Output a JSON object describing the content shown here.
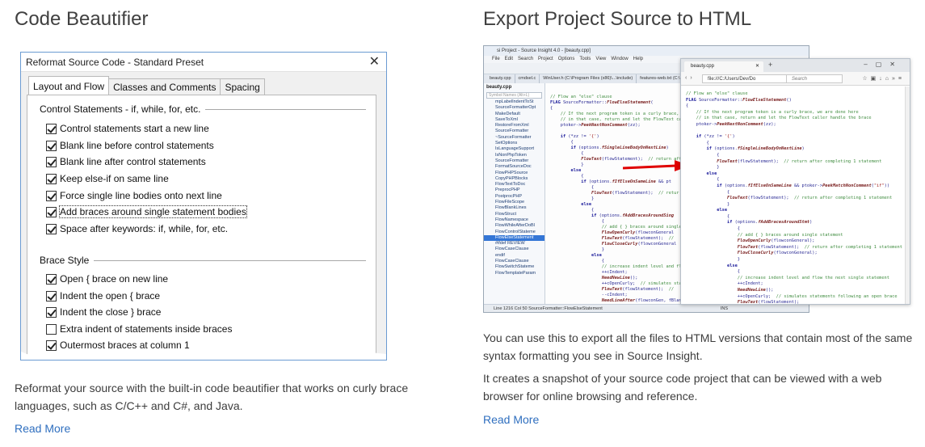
{
  "left": {
    "title": "Code Beautifier",
    "dialog": {
      "title": "Reformat Source Code - Standard Preset",
      "tabs": [
        "Layout and Flow",
        "Classes and Comments",
        "Spacing"
      ],
      "groups": [
        {
          "label": "Control Statements - if, while, for, etc.",
          "options": [
            {
              "label": "Control statements start a new line",
              "checked": true
            },
            {
              "label": "Blank line before control statements",
              "checked": true
            },
            {
              "label": "Blank line after control statements",
              "checked": true
            },
            {
              "label": "Keep else-if on same line",
              "checked": true
            },
            {
              "label": "Force single line bodies onto next line",
              "checked": true
            },
            {
              "label": "Add braces around single statement bodies",
              "checked": true
            },
            {
              "label": "Space after keywords: if, while, for, etc.",
              "checked": true
            }
          ]
        },
        {
          "label": "Brace Style",
          "options": [
            {
              "label": "Open { brace on new line",
              "checked": true
            },
            {
              "label": "Indent the open { brace",
              "checked": true
            },
            {
              "label": "Indent the close } brace",
              "checked": true
            },
            {
              "label": "Extra indent of statements inside braces",
              "checked": false
            },
            {
              "label": "Outermost braces at column 1",
              "checked": true
            }
          ]
        }
      ]
    },
    "description": "Reformat your source with the built-in code beautifier that works on curly brace languages, such as C/C++ and C#, and Java.",
    "read_more": "Read More"
  },
  "right": {
    "title": "Export Project Source to HTML",
    "screenshot": {
      "editor_title": "si Project - Source Insight 4.0 - [beauty.cpp]",
      "editor_menu": [
        "File",
        "Edit",
        "Search",
        "Project",
        "Options",
        "Tools",
        "View",
        "Window",
        "Help"
      ],
      "editor_tabs": [
        "beauty.cpp",
        "cmdsel.c",
        "WinUser.h (C:\\Program Files (x86)\\...\\include)",
        "features-web.txt (C:\\Users..."
      ],
      "sidebar_title": "beauty.cpp",
      "sidebar_search": "Symbol Names (Alt+L)",
      "sidebar_items": [
        "mpLabelIndentToSt",
        "SourceFormatterOpt",
        "MakeDefault",
        "SaveToXml",
        "RestoreFromXml",
        "SourceFormatter",
        "~SourceFormatter",
        "SetOptions",
        "IsLanguageSupport",
        "IsNonPhpToken",
        "SourceFormatter",
        "FormatSourceDoc",
        "FlowPHPSource",
        "CopyPHPBlocks",
        "FlowTextToDoc",
        "PreprocPHP",
        "PostprocPHP",
        "FlowFileScope",
        "FlowBlankLines",
        "FlowStruct",
        "FlowNamespace",
        "FlowWhileAfterDoBl",
        "FlowControlStateme",
        "FlowElseStatement",
        "#ifdef REVIEW",
        "FlowCaseClause",
        "endif",
        "FlowCaseClause",
        "FlowSwitchStateme",
        "FlowTemplateParam"
      ],
      "selected_sidebar_item": 23,
      "editor_status": "Line 1216  Col 50  SourceFormatter::FlowElseStatement",
      "editor_status_right": "INS",
      "browser_tab": "beauty.cpp",
      "browser_url": "file:///C:/Users/Dev/Do",
      "browser_search": "Search"
    },
    "description_1": "You can use this to export all the files to HTML versions that contain most of the same syntax formatting you see in Source Insight.",
    "description_2": "It creates a snapshot of your source code project that can be viewed with a web browser for online browsing and reference.",
    "read_more": "Read More"
  },
  "colors": {
    "link": "#2f6fbf",
    "heading": "#404040",
    "arrow": "#e00000",
    "dialog_border": "#6b9bd2"
  }
}
